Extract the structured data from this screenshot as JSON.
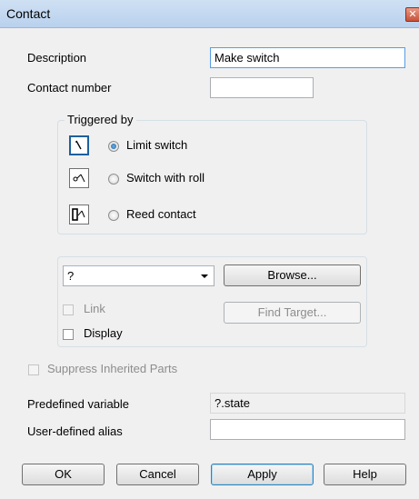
{
  "window": {
    "title": "Contact",
    "close_glyph": "✕"
  },
  "fields": {
    "description_label": "Description",
    "description_value": "Make switch",
    "contact_number_label": "Contact number",
    "contact_number_value": ""
  },
  "triggered_by": {
    "title": "Triggered by",
    "options": [
      {
        "label": "Limit switch",
        "icon": "limit-switch-icon",
        "selected": true
      },
      {
        "label": "Switch with roll",
        "icon": "switch-with-roll-icon",
        "selected": false
      },
      {
        "label": "Reed contact",
        "icon": "reed-contact-icon",
        "selected": false
      }
    ]
  },
  "target": {
    "combo_value": "?",
    "browse_label": "Browse...",
    "link_label": "Link",
    "find_target_label": "Find Target...",
    "display_label": "Display"
  },
  "suppress_label": "Suppress Inherited Parts",
  "variables": {
    "predefined_label": "Predefined variable",
    "predefined_value": "?.state",
    "alias_label": "User-defined alias",
    "alias_value": ""
  },
  "buttons": {
    "ok": "OK",
    "cancel": "Cancel",
    "apply": "Apply",
    "help": "Help"
  },
  "colors": {
    "accent": "#1f5f9e",
    "titlebar": "#b9d1ee",
    "close": "#c85139"
  }
}
